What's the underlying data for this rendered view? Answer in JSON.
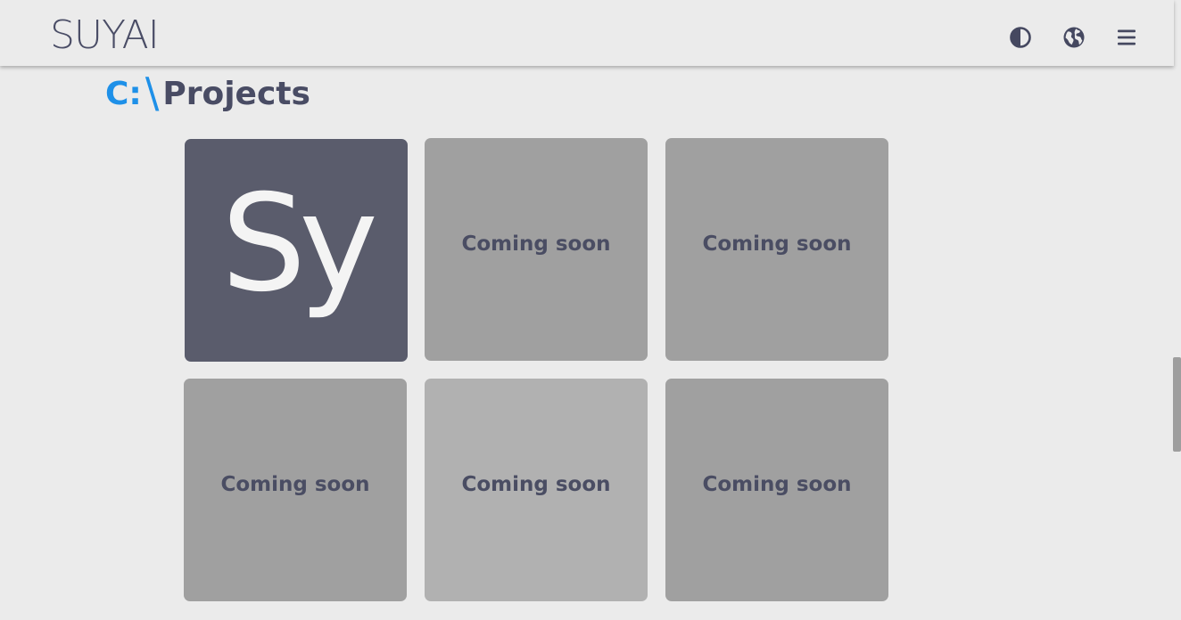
{
  "header": {
    "logo": "SUYAI",
    "icons": [
      "contrast-icon",
      "globe-icon",
      "hamburger-menu-icon"
    ]
  },
  "heading": {
    "drive": "C:",
    "separator": "\\",
    "title": "Projects"
  },
  "projects": [
    {
      "logo_text": "Sy",
      "label": ""
    },
    {
      "label": "Coming soon"
    },
    {
      "label": "Coming soon"
    },
    {
      "label": "Coming soon"
    },
    {
      "label": "Coming soon"
    },
    {
      "label": "Coming soon"
    }
  ],
  "colors": {
    "background": "#ebebeb",
    "accent": "#1e90e8",
    "text_dark": "#494c64",
    "tile_dark": "#5a5c6c",
    "tile_grey": "#a0a0a0",
    "tile_light": "#b1b1b1"
  }
}
